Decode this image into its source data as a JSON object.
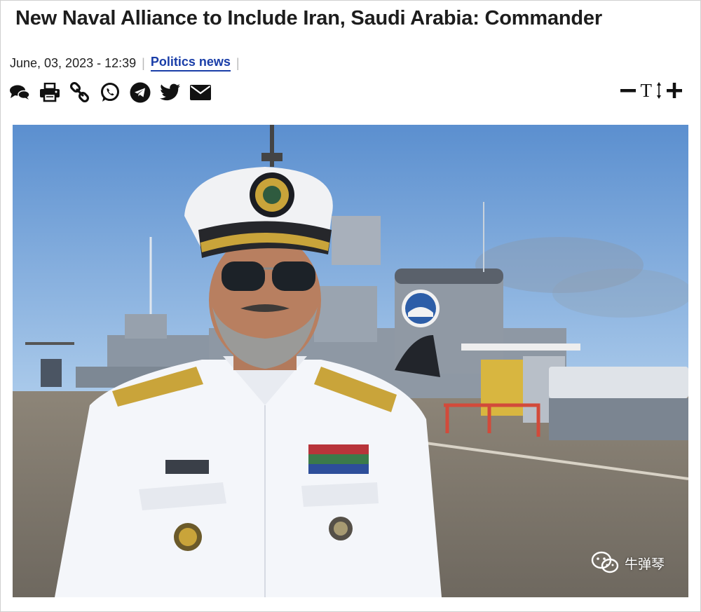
{
  "article": {
    "title": "New Naval Alliance to Include Iran, Saudi Arabia: Commander",
    "date": "June, 03, 2023 - 12:39",
    "separator": "|",
    "category": "Politics news"
  },
  "share_icons": [
    "comment-icon",
    "print-icon",
    "link-icon",
    "whatsapp-icon",
    "telegram-icon",
    "twitter-icon",
    "email-icon"
  ],
  "font_controls": {
    "decrease": "decrease-font-icon",
    "label": "T",
    "increase": "increase-font-icon"
  },
  "photo": {
    "watermark": "牛弹琴",
    "sky_color": "#6f9fd4",
    "uniform_color": "#f4f6fa",
    "gold_color": "#c9a43a"
  }
}
